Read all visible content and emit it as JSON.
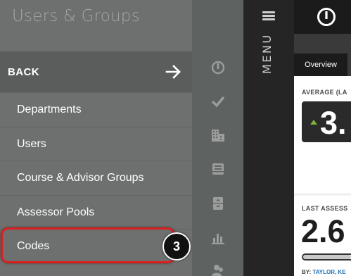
{
  "panel": {
    "title": "Users & Groups",
    "back_label": "BACK",
    "items": [
      {
        "label": "Departments"
      },
      {
        "label": "Users"
      },
      {
        "label": "Course & Advisor Groups"
      },
      {
        "label": "Assessor Pools"
      },
      {
        "label": "Codes"
      }
    ]
  },
  "callout": {
    "step_number": "3",
    "highlight_color": "#dc1e1e"
  },
  "rail": {
    "icons": [
      "dashboard-gauge-icon",
      "checkmark-icon",
      "building-icon",
      "inbox-tray-icon",
      "file-cabinet-icon",
      "bar-chart-icon",
      "people-icon"
    ]
  },
  "menubar": {
    "label": "MENU",
    "icon": "hamburger-icon"
  },
  "dashboard": {
    "logo_icon": "gauge-logo-icon",
    "tabs": [
      {
        "label": "Overview",
        "active": true
      }
    ],
    "average_card": {
      "label": "AVERAGE (LA",
      "value": "3.",
      "trend": "up",
      "trend_color": "#7fb23a"
    },
    "last_card": {
      "label": "LAST ASSESS",
      "value": "2.6",
      "by_prefix": "BY:",
      "by_name": "TAYLOR, KE",
      "progress": 0.9
    }
  }
}
